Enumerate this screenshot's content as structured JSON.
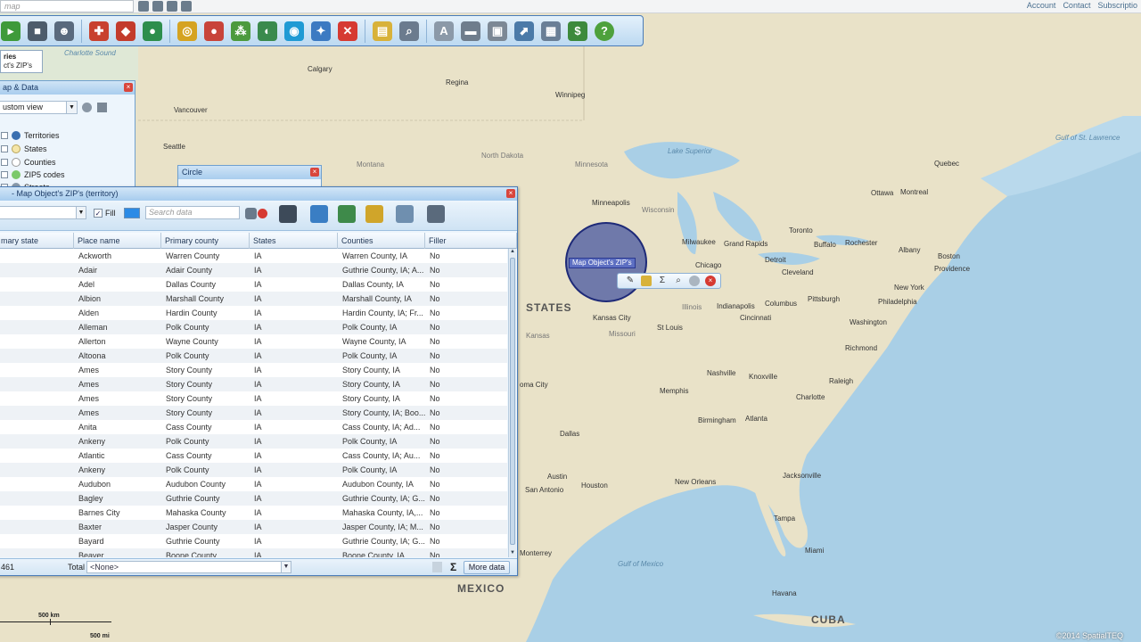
{
  "topbar": {
    "search_placeholder": "map",
    "links": [
      "Account",
      "Contact",
      "Subscriptio"
    ]
  },
  "legend_tab": {
    "line1": "ries",
    "line2": "ct's ZIP's"
  },
  "mapdata_panel": {
    "title": "ap & Data",
    "view_select": "ustom view",
    "layers": [
      "Territories",
      "States",
      "Counties",
      "ZIP5 codes",
      "Streets"
    ]
  },
  "circle_panel": {
    "title": "Circle"
  },
  "grid": {
    "title": "- Map Object's ZIP's (territory)",
    "fill_label": "Fill",
    "search_placeholder": "Search data",
    "columns": [
      "mary state",
      "Place name",
      "Primary county",
      "States",
      "Counties",
      "Filler"
    ],
    "rows": [
      [
        "",
        "Ackworth",
        "Warren County",
        "IA",
        "Warren County, IA",
        "No"
      ],
      [
        "",
        "Adair",
        "Adair County",
        "IA",
        "Guthrie County, IA; A...",
        "No"
      ],
      [
        "",
        "Adel",
        "Dallas County",
        "IA",
        "Dallas County, IA",
        "No"
      ],
      [
        "",
        "Albion",
        "Marshall County",
        "IA",
        "Marshall County, IA",
        "No"
      ],
      [
        "",
        "Alden",
        "Hardin County",
        "IA",
        "Hardin County, IA; Fr...",
        "No"
      ],
      [
        "",
        "Alleman",
        "Polk County",
        "IA",
        "Polk County, IA",
        "No"
      ],
      [
        "",
        "Allerton",
        "Wayne County",
        "IA",
        "Wayne County, IA",
        "No"
      ],
      [
        "",
        "Altoona",
        "Polk County",
        "IA",
        "Polk County, IA",
        "No"
      ],
      [
        "",
        "Ames",
        "Story County",
        "IA",
        "Story County, IA",
        "No"
      ],
      [
        "",
        "Ames",
        "Story County",
        "IA",
        "Story County, IA",
        "No"
      ],
      [
        "",
        "Ames",
        "Story County",
        "IA",
        "Story County, IA",
        "No"
      ],
      [
        "",
        "Ames",
        "Story County",
        "IA",
        "Story County, IA; Boo...",
        "No"
      ],
      [
        "",
        "Anita",
        "Cass County",
        "IA",
        "Cass County, IA; Ad...",
        "No"
      ],
      [
        "",
        "Ankeny",
        "Polk County",
        "IA",
        "Polk County, IA",
        "No"
      ],
      [
        "",
        "Atlantic",
        "Cass County",
        "IA",
        "Cass County, IA; Au...",
        "No"
      ],
      [
        "",
        "Ankeny",
        "Polk County",
        "IA",
        "Polk County, IA",
        "No"
      ],
      [
        "",
        "Audubon",
        "Audubon County",
        "IA",
        "Audubon County, IA",
        "No"
      ],
      [
        "",
        "Bagley",
        "Guthrie County",
        "IA",
        "Guthrie County, IA; G...",
        "No"
      ],
      [
        "",
        "Barnes City",
        "Mahaska County",
        "IA",
        "Mahaska County, IA,...",
        "No"
      ],
      [
        "",
        "Baxter",
        "Jasper County",
        "IA",
        "Jasper County, IA; M...",
        "No"
      ],
      [
        "",
        "Bayard",
        "Guthrie County",
        "IA",
        "Guthrie County, IA; G...",
        "No"
      ],
      [
        "",
        "Beaver",
        "Boone County",
        "IA",
        "Boone County, IA",
        "No"
      ]
    ],
    "footer_count": "461",
    "footer_total_label": "Total",
    "footer_total_value": "<None>",
    "more_data": "More data"
  },
  "circle_label": "Map Object's ZIP's",
  "scale": {
    "km": "500 km",
    "mi": "500 mi"
  },
  "copyright": "©2014 SpatialTEQ",
  "map_labels": [
    {
      "t": "Calgary",
      "c": ""
    },
    {
      "t": "Regina",
      "c": ""
    },
    {
      "t": "Winnipeg",
      "c": ""
    },
    {
      "t": "Vancouver",
      "c": ""
    },
    {
      "t": "Seattle",
      "c": ""
    },
    {
      "t": "Charlotte Sound",
      "c": "water"
    },
    {
      "t": "Montana",
      "c": "region"
    },
    {
      "t": "North Dakota",
      "c": "region"
    },
    {
      "t": "Minnesota",
      "c": "region"
    },
    {
      "t": "Minneapolis",
      "c": ""
    },
    {
      "t": "Wisconsin",
      "c": "region"
    },
    {
      "t": "Lake Superior",
      "c": "water"
    },
    {
      "t": "Milwaukee",
      "c": ""
    },
    {
      "t": "Grand Rapids",
      "c": ""
    },
    {
      "t": "Chicago",
      "c": ""
    },
    {
      "t": "Detroit",
      "c": ""
    },
    {
      "t": "Toronto",
      "c": ""
    },
    {
      "t": "Buffalo",
      "c": ""
    },
    {
      "t": "Rochester",
      "c": ""
    },
    {
      "t": "Ottawa",
      "c": ""
    },
    {
      "t": "Montreal",
      "c": ""
    },
    {
      "t": "Quebec",
      "c": ""
    },
    {
      "t": "Albany",
      "c": ""
    },
    {
      "t": "Boston",
      "c": ""
    },
    {
      "t": "Providence",
      "c": ""
    },
    {
      "t": "New York",
      "c": ""
    },
    {
      "t": "Philadelphia",
      "c": ""
    },
    {
      "t": "Pittsburgh",
      "c": ""
    },
    {
      "t": "Cleveland",
      "c": ""
    },
    {
      "t": "Columbus",
      "c": ""
    },
    {
      "t": "Cincinnati",
      "c": ""
    },
    {
      "t": "Indianapolis",
      "c": ""
    },
    {
      "t": "Washington",
      "c": ""
    },
    {
      "t": "Richmond",
      "c": ""
    },
    {
      "t": "Raleigh",
      "c": ""
    },
    {
      "t": "Charlotte",
      "c": ""
    },
    {
      "t": "Knoxville",
      "c": ""
    },
    {
      "t": "Nashville",
      "c": ""
    },
    {
      "t": "Memphis",
      "c": ""
    },
    {
      "t": "Birmingham",
      "c": ""
    },
    {
      "t": "Atlanta",
      "c": ""
    },
    {
      "t": "Jacksonville",
      "c": ""
    },
    {
      "t": "Tampa",
      "c": ""
    },
    {
      "t": "Miami",
      "c": ""
    },
    {
      "t": "Havana",
      "c": ""
    },
    {
      "t": "CUBA",
      "c": "big"
    },
    {
      "t": "New Orleans",
      "c": ""
    },
    {
      "t": "Houston",
      "c": ""
    },
    {
      "t": "San Antonio",
      "c": ""
    },
    {
      "t": "Austin",
      "c": ""
    },
    {
      "t": "Dallas",
      "c": ""
    },
    {
      "t": "oma City",
      "c": ""
    },
    {
      "t": "Kansas City",
      "c": ""
    },
    {
      "t": "St Louis",
      "c": ""
    },
    {
      "t": "Missouri",
      "c": "region"
    },
    {
      "t": "Kansas",
      "c": "region"
    },
    {
      "t": "Illinois",
      "c": "region"
    },
    {
      "t": "STATES",
      "c": "big"
    },
    {
      "t": "MEXICO",
      "c": "big"
    },
    {
      "t": "Gulf of Mexico",
      "c": "water"
    },
    {
      "t": "Gulf of St. Lawrence",
      "c": "water"
    },
    {
      "t": "Monterrey",
      "c": ""
    }
  ]
}
